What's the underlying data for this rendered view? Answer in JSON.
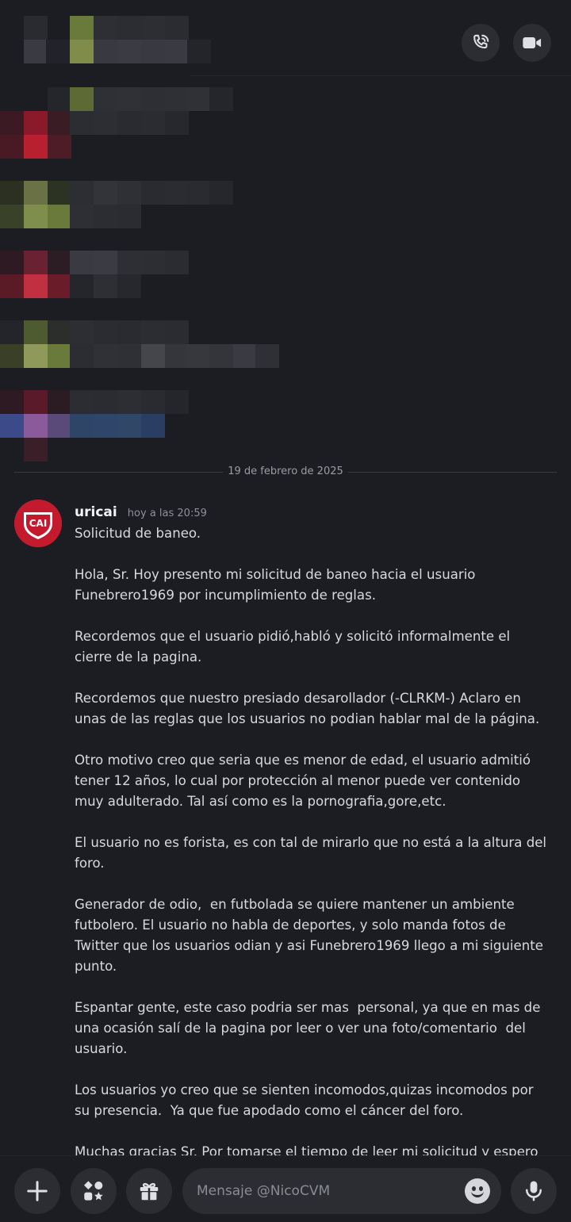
{
  "header": {
    "call_icon": "phone-call-icon",
    "video_icon": "video-camera-icon"
  },
  "date_divider": "19 de febrero de 2025",
  "message": {
    "username": "uricai",
    "timestamp": "hoy a las 20:59",
    "avatar_text": "CAI",
    "avatar_color": "#c41a2e",
    "paragraphs": [
      "Solicitud de baneo.",
      "Hola, Sr. Hoy presento mi solicitud de baneo hacia el usuario Funebrero1969 por incumplimiento de reglas.",
      "Recordemos que el usuario pidió,habló y solicitó informalmente el cierre de la pagina.",
      "Recordemos que nuestro presiado desarollador (-CLRKM-) Aclaro en unas de las reglas que los usuarios no podian hablar mal de la página.",
      "Otro motivo creo que seria que es menor de edad, el usuario admitió tener 12 años, lo cual por protección al menor puede ver contenido muy adulterado. Tal así como es la pornografia,gore,etc.",
      "El usuario no es forista, es con tal de mirarlo que no está a la altura del foro.",
      "Generador de odio,  en futbolada se quiere mantener un ambiente futbolero. El usuario no habla de deportes, y solo manda fotos de Twitter que los usuarios odian y asi Funebrero1969 llego a mi siguiente punto.",
      "Espantar gente, este caso podria ser mas  personal, ya que en mas de una ocasión salí de la pagina por leer o ver una foto/comentario  del usuario.",
      "Los usuarios yo creo que se sienten incomodos,quizas incomodos por su presencia.  Ya que fue apodado como el cáncer del foro.",
      "Muchas gracias Sr. Por tomarse el tiempo de leer mi solicitud y espero con ansias su respectiva respuesta. Atte: uricai"
    ]
  },
  "composer": {
    "placeholder": "Mensaje @NicoCVM",
    "add_icon": "plus-icon",
    "apps_icon": "apps-icon",
    "gift_icon": "gift-icon",
    "emoji_icon": "emoji-icon",
    "mic_icon": "microphone-icon"
  },
  "colors": {
    "background": "#1c1d22",
    "button_bg": "#2b2d33",
    "accent_red": "#c41a2e"
  }
}
